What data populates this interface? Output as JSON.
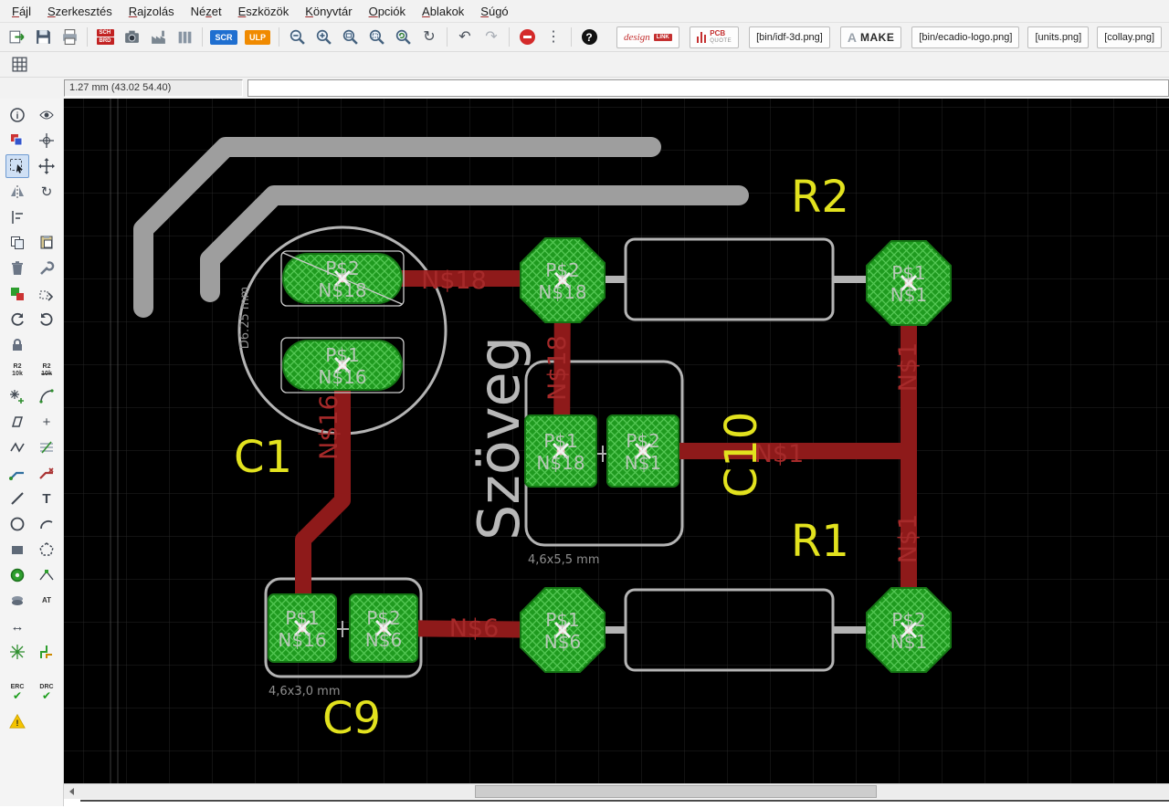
{
  "menubar": {
    "items": [
      {
        "label": "Fájl",
        "accel": 0
      },
      {
        "label": "Szerkesztés",
        "accel": 0
      },
      {
        "label": "Rajzolás",
        "accel": 0
      },
      {
        "label": "Nézet",
        "accel": 2
      },
      {
        "label": "Eszközök",
        "accel": 0
      },
      {
        "label": "Könyvtár",
        "accel": 0
      },
      {
        "label": "Opciók",
        "accel": 0
      },
      {
        "label": "Ablakok",
        "accel": 0
      },
      {
        "label": "Súgó",
        "accel": 0
      }
    ]
  },
  "toolbar": {
    "sch": "SCH",
    "brd": "BRD",
    "scr": "SCR",
    "ulp": "ULP",
    "design_link_script": "design",
    "design_link_chip": "LINK",
    "pcb_quote_top": "PCB",
    "pcb_quote_bottom": "QUOTE",
    "idf_label": "[bin/idf-3d.png]",
    "make_logo": "A",
    "make_label": "MAKE",
    "ecadio_label": "[bin/ecadio-logo.png]",
    "units_label": "[units.png]",
    "collay_label": "[collay.png]"
  },
  "coordbar": {
    "position": "1.27 mm (43.02 54.40)",
    "command": ""
  },
  "palette": {
    "name_tool": {
      "l1": "R2",
      "l2": "10k"
    },
    "value_tool": {
      "l1": "R2",
      "l2": "10k"
    },
    "attribute": "AT",
    "erc": "ERC",
    "drc": "DRC"
  },
  "icons": {
    "info": "i",
    "help": "?",
    "rotate": "↻",
    "refresh": "↻",
    "undo": "↶",
    "redo": "↷",
    "dots": "⋮",
    "pinswap": "↔",
    "crosshair": "+",
    "text_tool": "T",
    "check": "✔",
    "warning": "!"
  },
  "canvas": {
    "names": [
      {
        "text": "R2"
      },
      {
        "text": "C1"
      },
      {
        "text": "C10"
      },
      {
        "text": "R1"
      },
      {
        "text": "C9"
      }
    ],
    "nets": [
      {
        "text": "N$18"
      },
      {
        "text": "N$18"
      },
      {
        "text": "N$16"
      },
      {
        "text": "N$1"
      },
      {
        "text": "N$1"
      },
      {
        "text": "N$1"
      },
      {
        "text": "N$6"
      }
    ],
    "texts": {
      "big": "Szöveg",
      "c1_dim": "D6.25 mm",
      "c10_dim": "4,6x5,5 mm",
      "c9_dim": "4,6x3,0 mm"
    },
    "pads": [
      {
        "l1": "P$2",
        "l2": "N$18"
      },
      {
        "l1": "P$1",
        "l2": "N$16"
      },
      {
        "l1": "P$2",
        "l2": "N$18"
      },
      {
        "l1": "P$1",
        "l2": "N$1"
      },
      {
        "l1": "P$1",
        "l2": "N$18"
      },
      {
        "l1": "P$2",
        "l2": "N$1"
      },
      {
        "l1": "P$1",
        "l2": "N$16"
      },
      {
        "l1": "P$2",
        "l2": "N$6"
      },
      {
        "l1": "P$1",
        "l2": "N$6"
      },
      {
        "l1": "P$2",
        "l2": "N$1"
      }
    ]
  }
}
